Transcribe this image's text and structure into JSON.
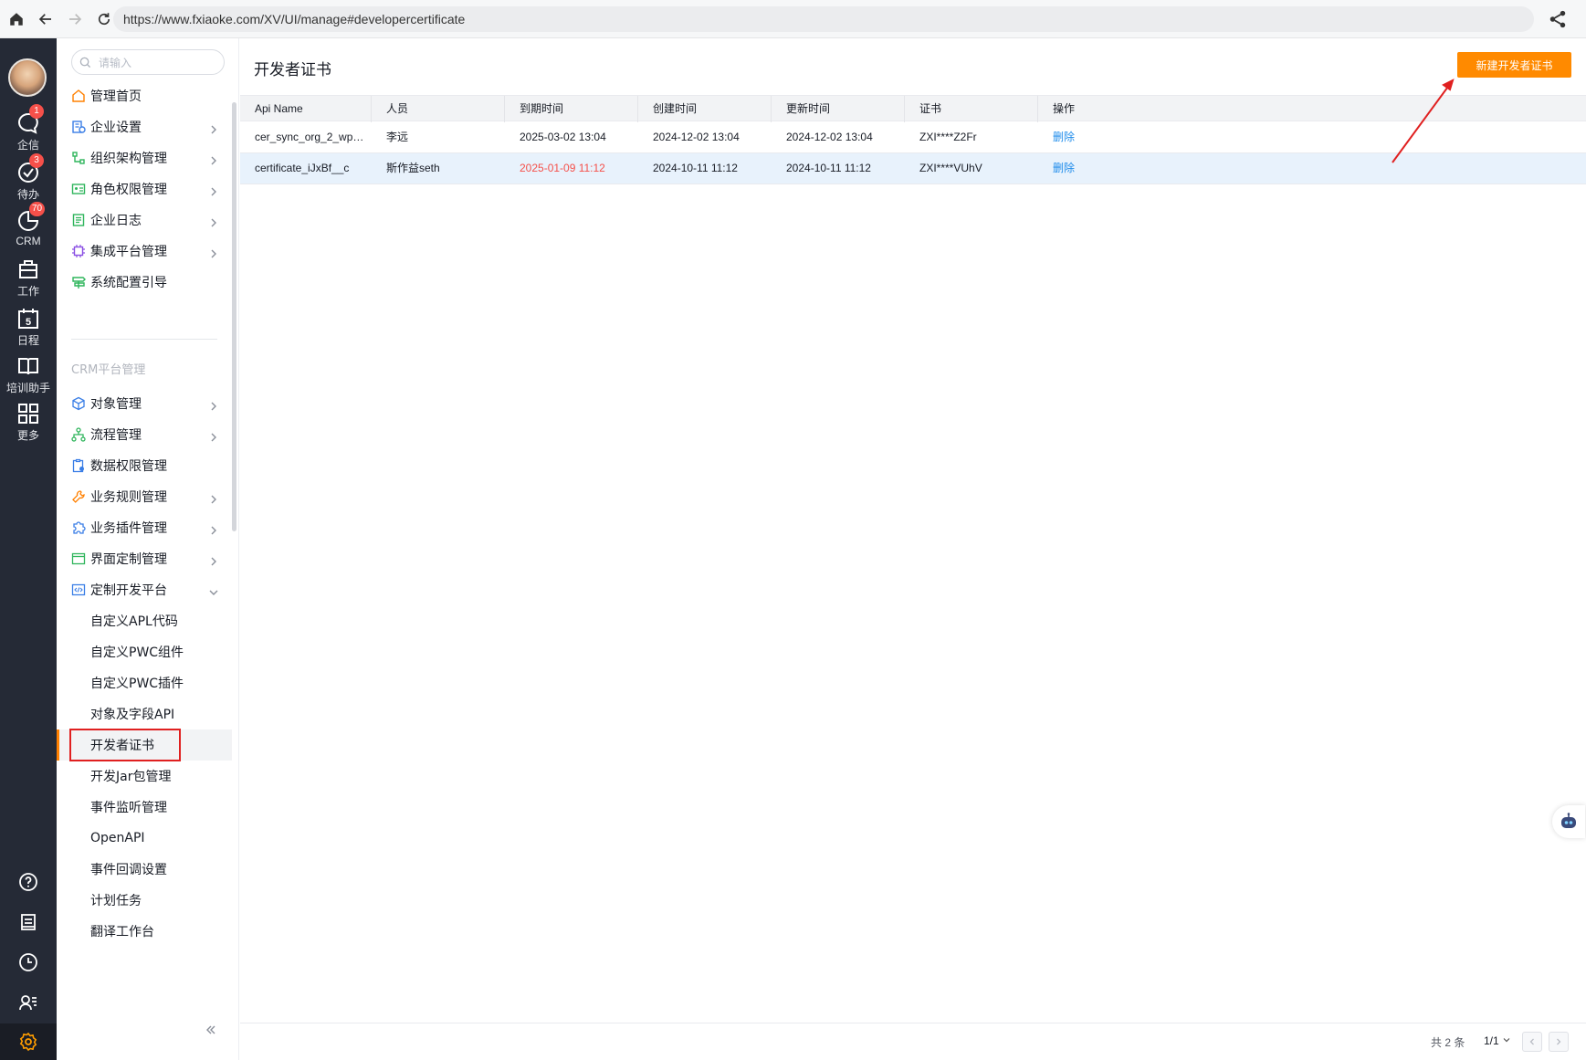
{
  "browser": {
    "url": "https://www.fxiaoke.com/XV/UI/manage#developercertificate"
  },
  "rail": {
    "items": [
      {
        "label": "企信",
        "badge": "1"
      },
      {
        "label": "待办",
        "badge": "3"
      },
      {
        "label": "CRM",
        "badge": "70"
      },
      {
        "label": "工作",
        "badge": ""
      },
      {
        "label": "日程",
        "badge": ""
      },
      {
        "label": "培训助手",
        "badge": ""
      },
      {
        "label": "更多",
        "badge": ""
      }
    ],
    "calendar_day": "5"
  },
  "sidebar": {
    "search_placeholder": "请输入",
    "items": [
      {
        "label": "管理首页"
      },
      {
        "label": "企业设置"
      },
      {
        "label": "组织架构管理"
      },
      {
        "label": "角色权限管理"
      },
      {
        "label": "企业日志"
      },
      {
        "label": "集成平台管理"
      },
      {
        "label": "系统配置引导"
      }
    ],
    "group_title": "CRM平台管理",
    "crm_items": [
      {
        "label": "对象管理"
      },
      {
        "label": "流程管理"
      },
      {
        "label": "数据权限管理"
      },
      {
        "label": "业务规则管理"
      },
      {
        "label": "业务插件管理"
      },
      {
        "label": "界面定制管理"
      },
      {
        "label": "定制开发平台"
      }
    ],
    "sub_items": [
      {
        "label": "自定义APL代码"
      },
      {
        "label": "自定义PWC组件"
      },
      {
        "label": "自定义PWC插件"
      },
      {
        "label": "对象及字段API"
      },
      {
        "label": "开发者证书"
      },
      {
        "label": "开发Jar包管理"
      },
      {
        "label": "事件监听管理"
      },
      {
        "label": "OpenAPI"
      },
      {
        "label": "事件回调设置"
      },
      {
        "label": "计划任务"
      },
      {
        "label": "翻译工作台"
      }
    ]
  },
  "main": {
    "title": "开发者证书",
    "new_button": "新建开发者证书",
    "columns": [
      "Api Name",
      "人员",
      "到期时间",
      "创建时间",
      "更新时间",
      "证书",
      "操作"
    ],
    "rows": [
      {
        "api_name": "cer_sync_org_2_wp…",
        "person": "李远",
        "expire": "2025-03-02 13:04",
        "created": "2024-12-02 13:04",
        "updated": "2024-12-02 13:04",
        "cert": "ZXI****Z2Fr",
        "action": "删除"
      },
      {
        "api_name": "certificate_iJxBf__c",
        "person": "斯作益seth",
        "expire": "2025-01-09 11:12",
        "created": "2024-10-11 11:12",
        "updated": "2024-10-11 11:12",
        "cert": "ZXI****VUhV",
        "action": "删除"
      }
    ],
    "footer": {
      "total": "共 2 条",
      "page": "1/1"
    }
  },
  "colors": {
    "accent": "#ff8a00",
    "expired": "#f5504a",
    "link": "#1f8ceb",
    "rail_bg": "#252a36"
  }
}
